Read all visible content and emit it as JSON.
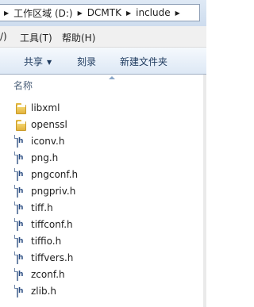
{
  "address": {
    "segments": [
      "工作区域 (D:)",
      "DCMTK",
      "include"
    ]
  },
  "menu": {
    "items": [
      "/)",
      "工具(T)",
      "帮助(H)"
    ]
  },
  "toolbar": {
    "share_label": "共享",
    "burn_label": "刻录",
    "new_folder_label": "新建文件夹"
  },
  "list": {
    "column_name": "名称",
    "items": [
      {
        "name": "libxml",
        "icon": "folder-icon"
      },
      {
        "name": "openssl",
        "icon": "folder-icon"
      },
      {
        "name": "iconv.h",
        "icon": "header-file-icon"
      },
      {
        "name": "png.h",
        "icon": "header-file-icon"
      },
      {
        "name": "pngconf.h",
        "icon": "header-file-icon"
      },
      {
        "name": "pngpriv.h",
        "icon": "header-file-icon"
      },
      {
        "name": "tiff.h",
        "icon": "header-file-icon"
      },
      {
        "name": "tiffconf.h",
        "icon": "header-file-icon"
      },
      {
        "name": "tiffio.h",
        "icon": "header-file-icon"
      },
      {
        "name": "tiffvers.h",
        "icon": "header-file-icon"
      },
      {
        "name": "zconf.h",
        "icon": "header-file-icon"
      },
      {
        "name": "zlib.h",
        "icon": "header-file-icon"
      }
    ]
  }
}
